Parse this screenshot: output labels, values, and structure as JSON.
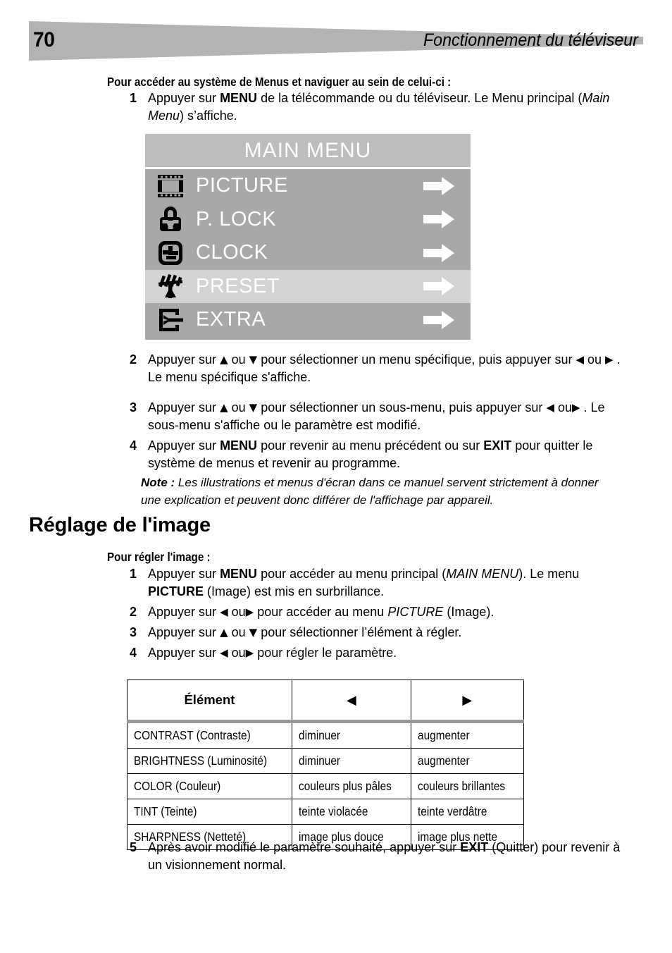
{
  "header": {
    "page_number": "70",
    "title": "Fonctionnement du téléviseur",
    "banner_color": "#b3b3b3"
  },
  "intro": {
    "lead_in": "Pour accéder au système de Menus et naviguer au sein de celui-ci :",
    "steps": [
      {
        "num": "1",
        "parts": [
          {
            "t": "Appuyer sur ",
            "s": "normal"
          },
          {
            "t": "MENU",
            "s": "bold"
          },
          {
            "t": " de la télécommande ou du téléviseur. Le Menu principal (",
            "s": "normal"
          },
          {
            "t": "Main Menu",
            "s": "italic"
          },
          {
            "t": ") s’affiche.",
            "s": "normal"
          }
        ]
      },
      {
        "num": "2",
        "parts": [
          {
            "t": "Appuyer sur ",
            "s": "normal"
          },
          {
            "t": "▲",
            "s": "glyph"
          },
          {
            "t": " ou ",
            "s": "normal"
          },
          {
            "t": "▼",
            "s": "glyph"
          },
          {
            "t": "  pour sélectionner un menu spécifique, puis appuyer sur ",
            "s": "normal"
          },
          {
            "t": "◀",
            "s": "glyph"
          },
          {
            "t": " ou ",
            "s": "normal"
          },
          {
            "t": "▶",
            "s": "glyph"
          },
          {
            "t": " . Le menu spécifique s'affiche.",
            "s": "normal"
          }
        ]
      },
      {
        "num": "3",
        "parts": [
          {
            "t": "Appuyer sur ",
            "s": "normal"
          },
          {
            "t": "▲",
            "s": "glyph"
          },
          {
            "t": " ou ",
            "s": "normal"
          },
          {
            "t": "▼",
            "s": "glyph"
          },
          {
            "t": "  pour sélectionner un sous-menu, puis appuyer sur ",
            "s": "normal"
          },
          {
            "t": "◀",
            "s": "glyph"
          },
          {
            "t": " ou",
            "s": "normal"
          },
          {
            "t": "▶",
            "s": "glyph"
          },
          {
            "t": " . Le sous-menu s'affiche ou le paramètre est modifié.",
            "s": "normal"
          }
        ]
      },
      {
        "num": "4",
        "parts": [
          {
            "t": "Appuyer sur ",
            "s": "normal"
          },
          {
            "t": "MENU",
            "s": "bold"
          },
          {
            "t": " pour revenir au menu précédent ou sur ",
            "s": "normal"
          },
          {
            "t": "EXIT",
            "s": "bold"
          },
          {
            "t": " pour quitter le système de menus et revenir au programme.",
            "s": "normal"
          }
        ]
      }
    ],
    "note_label": "Note :",
    "note_text": "Les illustrations et menus d'écran dans ce manuel servent strictement à donner une explication et peuvent donc différer de l'affichage par appareil."
  },
  "osd_menu": {
    "title": "MAIN  MENU",
    "title_bg": "#bdbdbd",
    "body_bg": "#a8a8a8",
    "highlight_bg": "#d3d3d3",
    "items": [
      {
        "label": "PICTURE",
        "icon": "film-strip-icon",
        "arrow": "right-arrow-icon",
        "highlighted": false
      },
      {
        "label": "P. LOCK",
        "icon": "padlock-icon",
        "arrow": "right-arrow-icon",
        "highlighted": false
      },
      {
        "label": "CLOCK",
        "icon": "clock-icon",
        "arrow": "right-arrow-icon",
        "highlighted": false
      },
      {
        "label": "PRESET",
        "icon": "antenna-icon",
        "arrow": "right-arrow-icon",
        "highlighted": true
      },
      {
        "label": "EXTRA",
        "icon": "wrench-box-icon",
        "arrow": "right-arrow-icon",
        "highlighted": false
      }
    ]
  },
  "section": {
    "heading": "Réglage de l'image",
    "lead_in": "Pour régler l'image :",
    "steps": [
      {
        "num": "1",
        "parts": [
          {
            "t": "Appuyer sur ",
            "s": "normal"
          },
          {
            "t": "MENU",
            "s": "bold"
          },
          {
            "t": " pour accéder au menu principal (",
            "s": "normal"
          },
          {
            "t": "MAIN MENU",
            "s": "italic"
          },
          {
            "t": "). Le menu ",
            "s": "normal"
          },
          {
            "t": "PICTURE",
            "s": "bold"
          },
          {
            "t": " (Image) est mis en surbrillance.",
            "s": "normal"
          }
        ]
      },
      {
        "num": "2",
        "parts": [
          {
            "t": "Appuyer sur ",
            "s": "normal"
          },
          {
            "t": "◀",
            "s": "glyph"
          },
          {
            "t": " ou",
            "s": "normal"
          },
          {
            "t": "▶",
            "s": "glyph"
          },
          {
            "t": " pour accéder au menu ",
            "s": "normal"
          },
          {
            "t": "PICTURE",
            "s": "italic"
          },
          {
            "t": " (Image).",
            "s": "normal"
          }
        ]
      },
      {
        "num": "3",
        "parts": [
          {
            "t": "Appuyer sur ",
            "s": "normal"
          },
          {
            "t": "▲",
            "s": "glyph"
          },
          {
            "t": "  ou ",
            "s": "normal"
          },
          {
            "t": "▼",
            "s": "glyph"
          },
          {
            "t": "  pour sélectionner l’élément à régler.",
            "s": "normal"
          }
        ]
      },
      {
        "num": "4",
        "parts": [
          {
            "t": "Appuyer sur ",
            "s": "normal"
          },
          {
            "t": "◀",
            "s": "glyph"
          },
          {
            "t": " ou",
            "s": "normal"
          },
          {
            "t": "▶",
            "s": "glyph"
          },
          {
            "t": " pour régler le paramètre.",
            "s": "normal"
          }
        ]
      }
    ],
    "final_step": {
      "num": "5",
      "parts": [
        {
          "t": "Après avoir modifié le paramètre souhaité, appuyer sur ",
          "s": "normal"
        },
        {
          "t": "EXIT",
          "s": "bold"
        },
        {
          "t": " (Quitter) pour revenir à un visionnement normal.",
          "s": "normal"
        }
      ]
    }
  },
  "table": {
    "headers": [
      "Élément",
      "◀",
      "▶"
    ],
    "rows": [
      [
        "CONTRAST (Contraste)",
        "diminuer",
        "augmenter"
      ],
      [
        "BRIGHTNESS (Luminosité)",
        "diminuer",
        "augmenter"
      ],
      [
        "COLOR (Couleur)",
        "couleurs plus pâles",
        "couleurs brillantes"
      ],
      [
        "TINT (Teinte)",
        "teinte violacée",
        "teinte verdâtre"
      ],
      [
        "SHARPNESS (Netteté)",
        "image plus douce",
        "image plus nette"
      ]
    ]
  }
}
